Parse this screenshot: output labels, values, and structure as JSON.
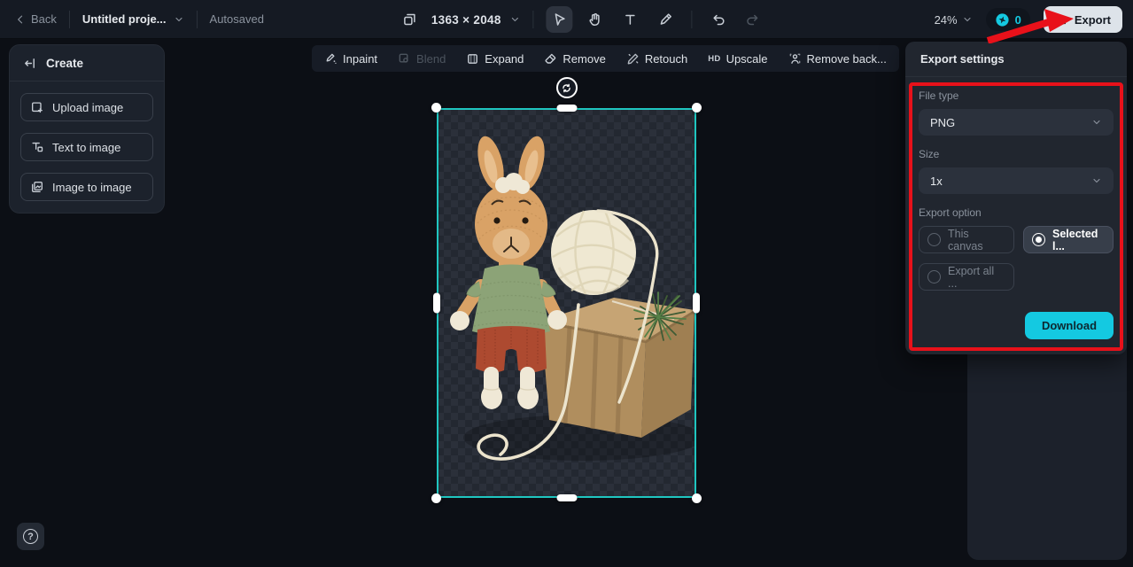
{
  "topbar": {
    "back_label": "Back",
    "project_name": "Untitled proje...",
    "autosave_status": "Autosaved",
    "canvas_size": "1363 × 2048",
    "zoom_level": "24%",
    "credits_count": "0",
    "export_label": "Export"
  },
  "create_panel": {
    "title": "Create",
    "items": [
      {
        "label": "Upload image"
      },
      {
        "label": "Text to image"
      },
      {
        "label": "Image to image"
      }
    ]
  },
  "canvas_toolbar": {
    "items": [
      {
        "label": "Inpaint",
        "disabled": false
      },
      {
        "label": "Blend",
        "disabled": true
      },
      {
        "label": "Expand",
        "disabled": false
      },
      {
        "label": "Remove",
        "disabled": false
      },
      {
        "label": "Retouch",
        "disabled": false
      },
      {
        "label": "Upscale",
        "hd_badge": "HD",
        "disabled": false
      },
      {
        "label": "Remove back...",
        "disabled": false
      }
    ]
  },
  "export_panel": {
    "title": "Export settings",
    "file_type_label": "File type",
    "file_type_value": "PNG",
    "size_label": "Size",
    "size_value": "1x",
    "option_label": "Export option",
    "options": [
      {
        "label": "This canvas",
        "selected": false
      },
      {
        "label": "Selected l...",
        "selected": true
      },
      {
        "label": "Export all ...",
        "selected": false
      }
    ],
    "download_label": "Download"
  },
  "help": {
    "label": "?"
  },
  "colors": {
    "accent_cyan": "#14c9e1",
    "selection_teal": "#1fc6c0",
    "highlight_red": "#e8111a",
    "export_button_bg": "#dde3e9"
  }
}
